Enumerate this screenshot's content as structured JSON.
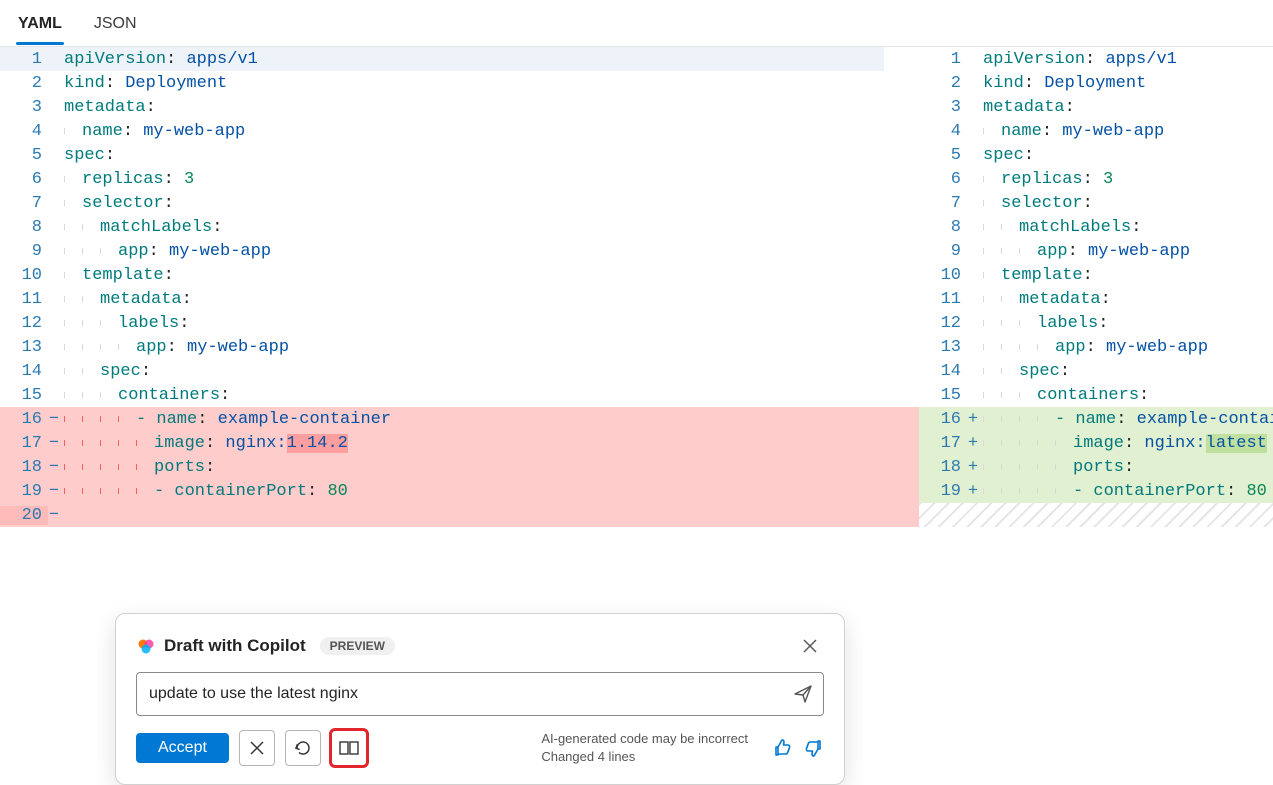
{
  "tabs": {
    "yaml": "YAML",
    "json": "JSON",
    "active": "yaml"
  },
  "left_code": [
    {
      "n": 1,
      "mark": "",
      "segs": [
        {
          "t": "apiVersion",
          "c": "tok-key"
        },
        {
          "t": ": "
        },
        {
          "t": "apps/v1",
          "c": "tok-val"
        }
      ]
    },
    {
      "n": 2,
      "mark": "",
      "segs": [
        {
          "t": "kind",
          "c": "tok-key"
        },
        {
          "t": ": "
        },
        {
          "t": "Deployment",
          "c": "tok-val"
        }
      ]
    },
    {
      "n": 3,
      "mark": "",
      "segs": [
        {
          "t": "metadata",
          "c": "tok-key"
        },
        {
          "t": ":"
        }
      ]
    },
    {
      "n": 4,
      "mark": "",
      "indent": 1,
      "segs": [
        {
          "t": "name",
          "c": "tok-key"
        },
        {
          "t": ": "
        },
        {
          "t": "my-web-app",
          "c": "tok-val"
        }
      ]
    },
    {
      "n": 5,
      "mark": "",
      "segs": [
        {
          "t": "spec",
          "c": "tok-key"
        },
        {
          "t": ":"
        }
      ]
    },
    {
      "n": 6,
      "mark": "",
      "indent": 1,
      "segs": [
        {
          "t": "replicas",
          "c": "tok-key"
        },
        {
          "t": ": "
        },
        {
          "t": "3",
          "c": "tok-num"
        }
      ]
    },
    {
      "n": 7,
      "mark": "",
      "indent": 1,
      "segs": [
        {
          "t": "selector",
          "c": "tok-key"
        },
        {
          "t": ":"
        }
      ]
    },
    {
      "n": 8,
      "mark": "",
      "indent": 2,
      "segs": [
        {
          "t": "matchLabels",
          "c": "tok-key"
        },
        {
          "t": ":"
        }
      ]
    },
    {
      "n": 9,
      "mark": "",
      "indent": 3,
      "segs": [
        {
          "t": "app",
          "c": "tok-key"
        },
        {
          "t": ": "
        },
        {
          "t": "my-web-app",
          "c": "tok-val"
        }
      ]
    },
    {
      "n": 10,
      "mark": "",
      "indent": 1,
      "segs": [
        {
          "t": "template",
          "c": "tok-key"
        },
        {
          "t": ":"
        }
      ]
    },
    {
      "n": 11,
      "mark": "",
      "indent": 2,
      "segs": [
        {
          "t": "metadata",
          "c": "tok-key"
        },
        {
          "t": ":"
        }
      ]
    },
    {
      "n": 12,
      "mark": "",
      "indent": 3,
      "segs": [
        {
          "t": "labels",
          "c": "tok-key"
        },
        {
          "t": ":"
        }
      ]
    },
    {
      "n": 13,
      "mark": "",
      "indent": 4,
      "segs": [
        {
          "t": "app",
          "c": "tok-key"
        },
        {
          "t": ": "
        },
        {
          "t": "my-web-app",
          "c": "tok-val"
        }
      ]
    },
    {
      "n": 14,
      "mark": "",
      "indent": 2,
      "segs": [
        {
          "t": "spec",
          "c": "tok-key"
        },
        {
          "t": ":"
        }
      ]
    },
    {
      "n": 15,
      "mark": "",
      "indent": 3,
      "segs": [
        {
          "t": "containers",
          "c": "tok-key"
        },
        {
          "t": ":"
        }
      ]
    },
    {
      "n": 16,
      "mark": "−",
      "removed": true,
      "indent": 4,
      "segs": [
        {
          "t": "- ",
          "c": "tok-dash"
        },
        {
          "t": "name",
          "c": "tok-key"
        },
        {
          "t": ": "
        },
        {
          "t": "example-container",
          "c": "tok-val"
        }
      ]
    },
    {
      "n": 17,
      "mark": "−",
      "removed": true,
      "indent": 5,
      "segs": [
        {
          "t": "image",
          "c": "tok-key"
        },
        {
          "t": ": "
        },
        {
          "t": "nginx:",
          "c": "tok-val"
        },
        {
          "t": "1.14.2",
          "c": "tok-val",
          "hl": "removed"
        }
      ]
    },
    {
      "n": 18,
      "mark": "−",
      "removed": true,
      "indent": 5,
      "segs": [
        {
          "t": "ports",
          "c": "tok-key"
        },
        {
          "t": ":"
        }
      ]
    },
    {
      "n": 19,
      "mark": "−",
      "removed": true,
      "indent": 5,
      "segs": [
        {
          "t": "- ",
          "c": "tok-dash"
        },
        {
          "t": "containerPort",
          "c": "tok-key"
        },
        {
          "t": ": "
        },
        {
          "t": "80",
          "c": "tok-num"
        }
      ]
    },
    {
      "n": 20,
      "mark": "−",
      "removed_extra": true,
      "segs": []
    }
  ],
  "right_code": [
    {
      "n": 1,
      "mark": "",
      "segs": [
        {
          "t": "apiVersion",
          "c": "tok-key"
        },
        {
          "t": ": "
        },
        {
          "t": "apps/v1",
          "c": "tok-val"
        }
      ]
    },
    {
      "n": 2,
      "mark": "",
      "segs": [
        {
          "t": "kind",
          "c": "tok-key"
        },
        {
          "t": ": "
        },
        {
          "t": "Deployment",
          "c": "tok-val"
        }
      ]
    },
    {
      "n": 3,
      "mark": "",
      "segs": [
        {
          "t": "metadata",
          "c": "tok-key"
        },
        {
          "t": ":"
        }
      ]
    },
    {
      "n": 4,
      "mark": "",
      "indent": 1,
      "segs": [
        {
          "t": "name",
          "c": "tok-key"
        },
        {
          "t": ": "
        },
        {
          "t": "my-web-app",
          "c": "tok-val"
        }
      ]
    },
    {
      "n": 5,
      "mark": "",
      "segs": [
        {
          "t": "spec",
          "c": "tok-key"
        },
        {
          "t": ":"
        }
      ]
    },
    {
      "n": 6,
      "mark": "",
      "indent": 1,
      "segs": [
        {
          "t": "replicas",
          "c": "tok-key"
        },
        {
          "t": ": "
        },
        {
          "t": "3",
          "c": "tok-num"
        }
      ]
    },
    {
      "n": 7,
      "mark": "",
      "indent": 1,
      "segs": [
        {
          "t": "selector",
          "c": "tok-key"
        },
        {
          "t": ":"
        }
      ]
    },
    {
      "n": 8,
      "mark": "",
      "indent": 2,
      "segs": [
        {
          "t": "matchLabels",
          "c": "tok-key"
        },
        {
          "t": ":"
        }
      ]
    },
    {
      "n": 9,
      "mark": "",
      "indent": 3,
      "segs": [
        {
          "t": "app",
          "c": "tok-key"
        },
        {
          "t": ": "
        },
        {
          "t": "my-web-app",
          "c": "tok-val"
        }
      ]
    },
    {
      "n": 10,
      "mark": "",
      "indent": 1,
      "segs": [
        {
          "t": "template",
          "c": "tok-key"
        },
        {
          "t": ":"
        }
      ]
    },
    {
      "n": 11,
      "mark": "",
      "indent": 2,
      "segs": [
        {
          "t": "metadata",
          "c": "tok-key"
        },
        {
          "t": ":"
        }
      ]
    },
    {
      "n": 12,
      "mark": "",
      "indent": 3,
      "segs": [
        {
          "t": "labels",
          "c": "tok-key"
        },
        {
          "t": ":"
        }
      ]
    },
    {
      "n": 13,
      "mark": "",
      "indent": 4,
      "segs": [
        {
          "t": "app",
          "c": "tok-key"
        },
        {
          "t": ": "
        },
        {
          "t": "my-web-app",
          "c": "tok-val"
        }
      ]
    },
    {
      "n": 14,
      "mark": "",
      "indent": 2,
      "segs": [
        {
          "t": "spec",
          "c": "tok-key"
        },
        {
          "t": ":"
        }
      ]
    },
    {
      "n": 15,
      "mark": "",
      "indent": 3,
      "segs": [
        {
          "t": "containers",
          "c": "tok-key"
        },
        {
          "t": ":"
        }
      ]
    },
    {
      "n": 16,
      "mark": "+",
      "added": true,
      "indent": 4,
      "segs": [
        {
          "t": "- ",
          "c": "tok-dash"
        },
        {
          "t": "name",
          "c": "tok-key"
        },
        {
          "t": ": "
        },
        {
          "t": "example-container",
          "c": "tok-val"
        }
      ]
    },
    {
      "n": 17,
      "mark": "+",
      "added": true,
      "indent": 5,
      "segs": [
        {
          "t": "image",
          "c": "tok-key"
        },
        {
          "t": ": "
        },
        {
          "t": "nginx:",
          "c": "tok-val"
        },
        {
          "t": "latest",
          "c": "tok-val",
          "hl": "added"
        }
      ]
    },
    {
      "n": 18,
      "mark": "+",
      "added": true,
      "indent": 5,
      "segs": [
        {
          "t": "ports",
          "c": "tok-key"
        },
        {
          "t": ":"
        }
      ]
    },
    {
      "n": 19,
      "mark": "+",
      "added": true,
      "indent": 5,
      "segs": [
        {
          "t": "- ",
          "c": "tok-dash"
        },
        {
          "t": "containerPort",
          "c": "tok-key"
        },
        {
          "t": ": "
        },
        {
          "t": "80",
          "c": "tok-num"
        }
      ]
    }
  ],
  "copilot": {
    "title": "Draft with Copilot",
    "badge": "PREVIEW",
    "input_value": "update to use the latest nginx",
    "accept": "Accept",
    "status_line1": "AI-generated code may be incorrect",
    "status_line2": "Changed 4 lines"
  }
}
